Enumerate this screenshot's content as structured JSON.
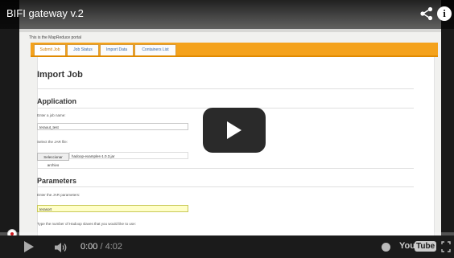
{
  "video": {
    "title": "BIFI gateway v.2",
    "current_time": "0:00",
    "separator": "/",
    "duration": "4:02",
    "progress": 0.0,
    "accent_color": "#cc181e"
  },
  "icons": {
    "share": "share-icon",
    "info": "info-icon",
    "info_glyph": "i",
    "play": "play-icon",
    "volume": "volume-icon",
    "watch_later": "clock-icon",
    "fullscreen": "fullscreen-icon"
  },
  "logo": {
    "you": "You",
    "tube": "Tube"
  },
  "embedded_page": {
    "portal_text": "This is the MapReduce portal",
    "tabs": [
      "Submit Job",
      "Job Status",
      "Import Data",
      "Containers List"
    ],
    "heading": "Import Job",
    "application": {
      "heading": "Application",
      "job_name_label": "Enter a job name:",
      "job_name_value": "teraout_test",
      "jar_label": "Select the JAR file:",
      "file_button": "Seleccionar archivo",
      "file_name": "hadoop-examples-1.0.3.jar"
    },
    "parameters": {
      "heading": "Parameters",
      "jar_params_label": "Enter the JAR parameters:",
      "jar_params_value": "terasort",
      "nodes_label": "Type the number of Hadoop slaves that you would like to use:"
    }
  }
}
